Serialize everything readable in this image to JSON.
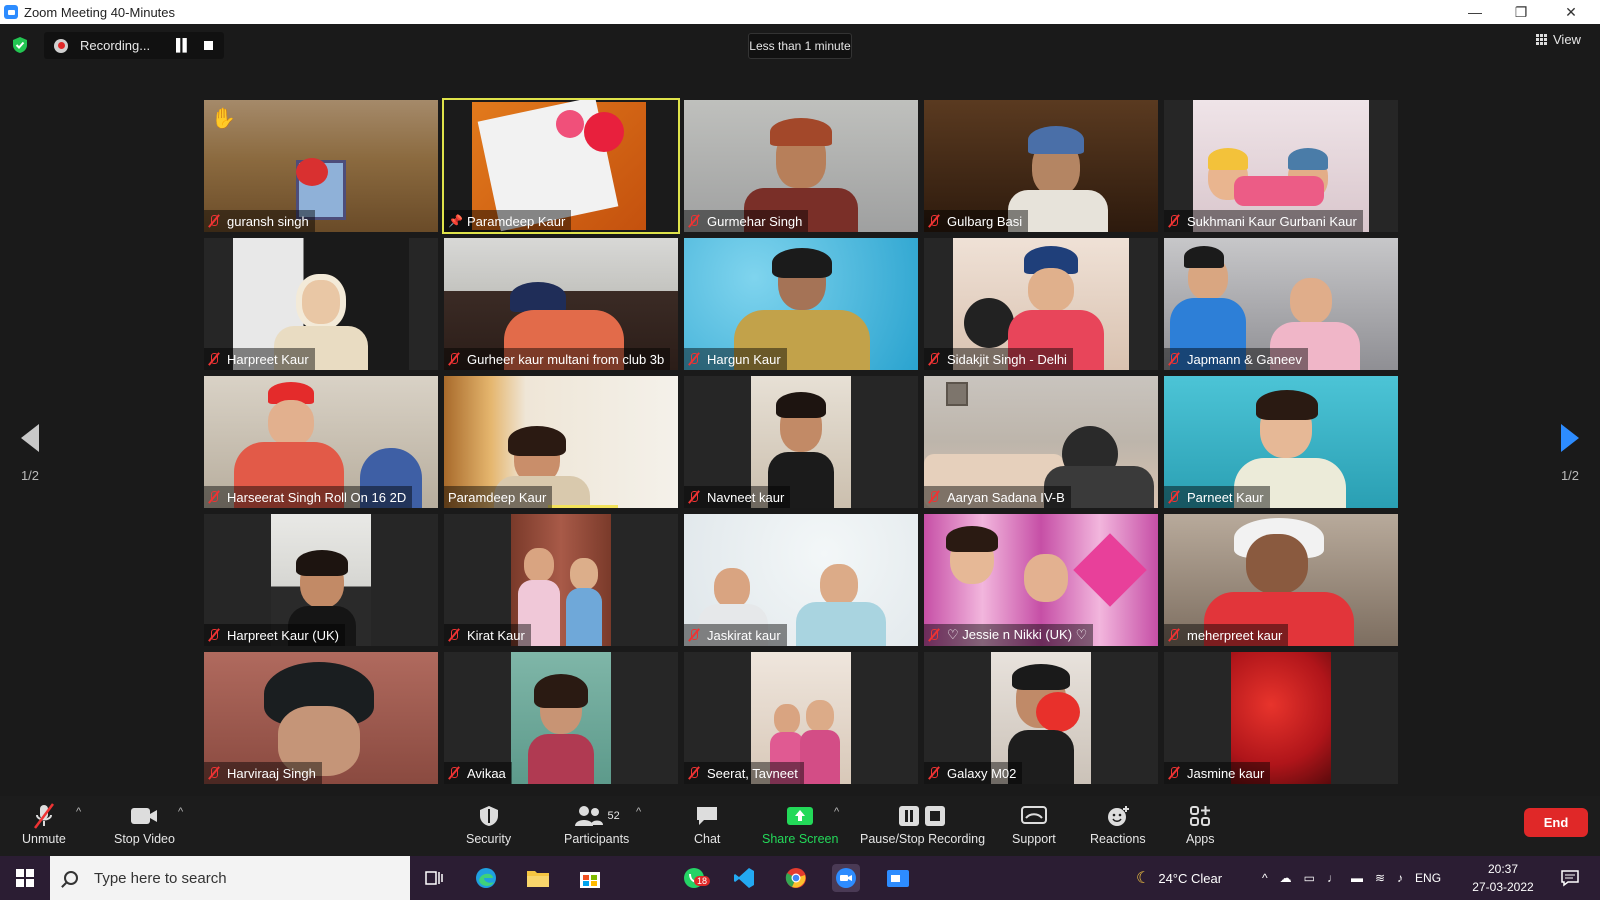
{
  "window": {
    "title": "Zoom Meeting 40-Minutes",
    "minimize": "—",
    "restore": "❐",
    "close": "✕"
  },
  "recording": {
    "label": "Recording..."
  },
  "timer": {
    "label": "Less than 1 minute"
  },
  "view": {
    "label": "View"
  },
  "pager": {
    "page": "1/2"
  },
  "participants": [
    {
      "name": "guransh singh",
      "muted": true,
      "hand_raised": true
    },
    {
      "name": "Paramdeep Kaur",
      "pinned": true,
      "active_speaker": true
    },
    {
      "name": "Gurmehar Singh",
      "muted": true
    },
    {
      "name": "Gulbarg Basi",
      "muted": true
    },
    {
      "name": "Sukhmani Kaur Gurbani Kaur",
      "muted": true
    },
    {
      "name": "Harpreet Kaur",
      "muted": true
    },
    {
      "name": "Gurheer kaur multani from club 3b",
      "muted": true
    },
    {
      "name": "Hargun Kaur",
      "muted": true
    },
    {
      "name": "Sidakjit Singh - Delhi",
      "muted": true
    },
    {
      "name": "Japmann & Ganeev",
      "muted": true
    },
    {
      "name": "Harseerat Singh Roll On 16 2D",
      "muted": true
    },
    {
      "name": "Paramdeep Kaur",
      "muted": false
    },
    {
      "name": "Navneet kaur",
      "muted": true
    },
    {
      "name": "Aaryan Sadana IV-B",
      "muted": true
    },
    {
      "name": "Parneet Kaur",
      "muted": true
    },
    {
      "name": "Harpreet Kaur (UK)",
      "muted": true
    },
    {
      "name": "Kirat Kaur",
      "muted": true
    },
    {
      "name": "Jaskirat kaur",
      "muted": true
    },
    {
      "name": "♡ Jessie n Nikki (UK) ♡",
      "muted": true
    },
    {
      "name": "meherpreet kaur",
      "muted": true
    },
    {
      "name": "Harviraaj Singh",
      "muted": true
    },
    {
      "name": "Avikaa",
      "muted": true
    },
    {
      "name": "Seerat, Tavneet",
      "muted": true
    },
    {
      "name": "Galaxy M02",
      "muted": true
    },
    {
      "name": "Jasmine kaur",
      "muted": true
    }
  ],
  "toolbar": {
    "unmute": "Unmute",
    "stop_video": "Stop Video",
    "security": "Security",
    "participants": "Participants",
    "participants_count": "52",
    "chat": "Chat",
    "share_screen": "Share Screen",
    "pause_stop_recording": "Pause/Stop Recording",
    "support": "Support",
    "reactions": "Reactions",
    "apps": "Apps",
    "end": "End"
  },
  "taskbar": {
    "search_placeholder": "Type here to search",
    "whatsapp_badge": "18",
    "weather": "24°C  Clear",
    "language": "ENG",
    "time": "20:37",
    "date": "27-03-2022"
  },
  "colors": {
    "accent": "#2d8cff",
    "end": "#e02828",
    "share": "#23d959",
    "active_border": "#dfe34a",
    "muted_icon": "#e33333"
  }
}
